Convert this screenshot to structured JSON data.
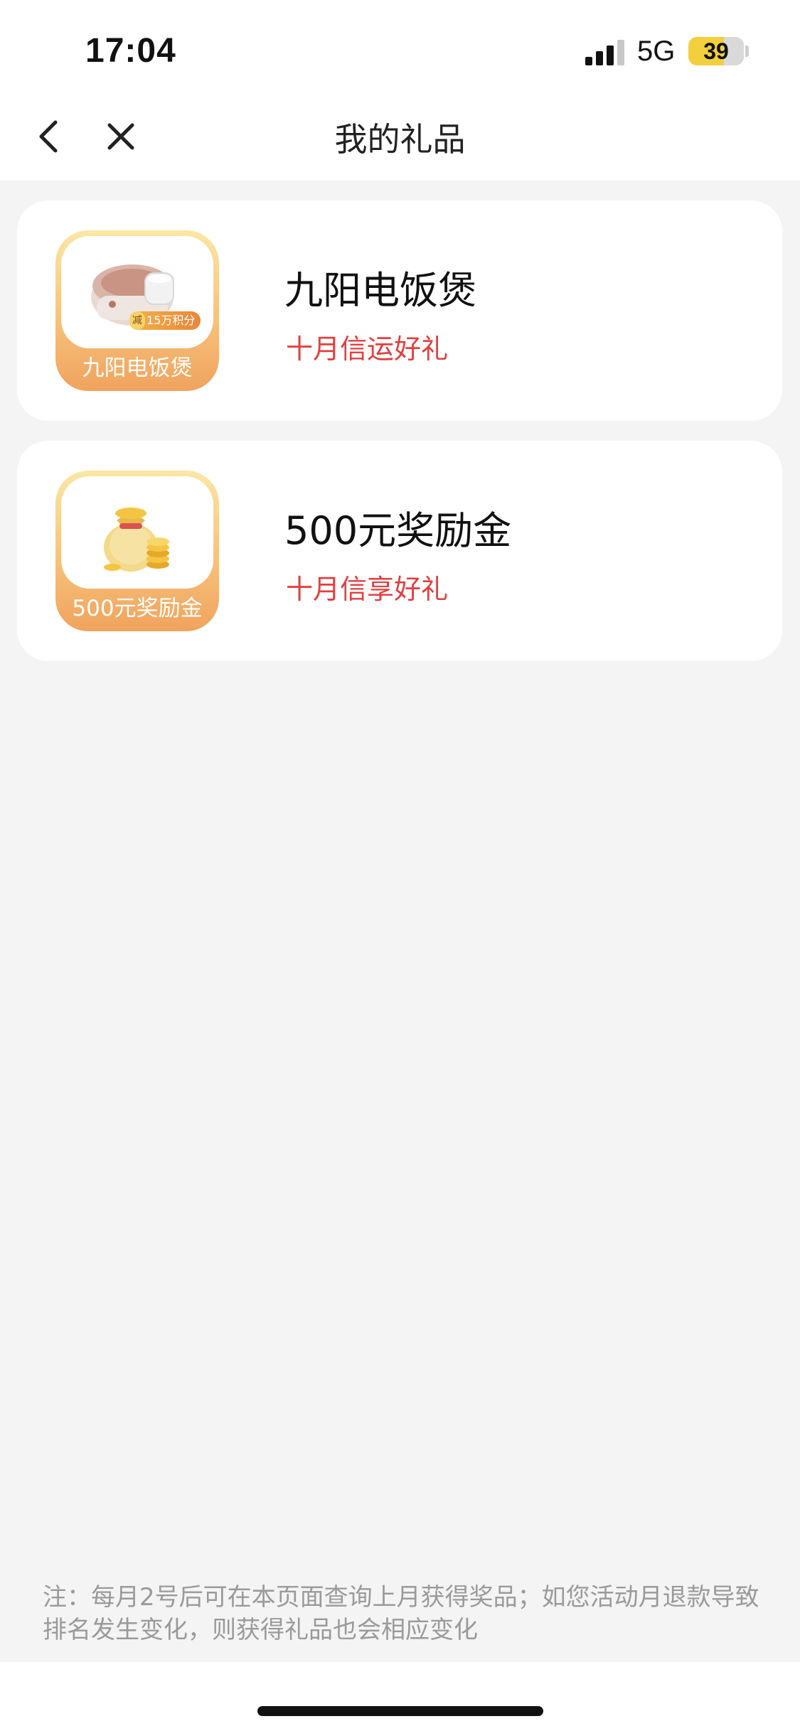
{
  "status_bar": {
    "time": "17:04",
    "network": "5G",
    "battery": "39"
  },
  "nav": {
    "title": "我的礼品",
    "back_icon": "chevron-left-icon",
    "close_icon": "close-icon"
  },
  "gifts": [
    {
      "name": "九阳电饭煲",
      "subtitle": "十月信运好礼",
      "thumb_label": "九阳电饭煲",
      "badge_tag": "减",
      "badge_text": "15万积分",
      "icon": "rice-cooker-icon"
    },
    {
      "name": "500元奖励金",
      "subtitle": "十月信享好礼",
      "thumb_label": "500元奖励金",
      "icon": "money-bag-icon"
    }
  ],
  "footnote": "注：每月2号后可在本页面查询上月获得奖品；如您活动月退款导致排名发生变化，则获得礼品也会相应变化",
  "colors": {
    "accent_red": "#e04040",
    "thumb_gradient_top": "#fbe7a6",
    "thumb_gradient_bottom": "#f0a35e",
    "background": "#f4f4f4"
  }
}
